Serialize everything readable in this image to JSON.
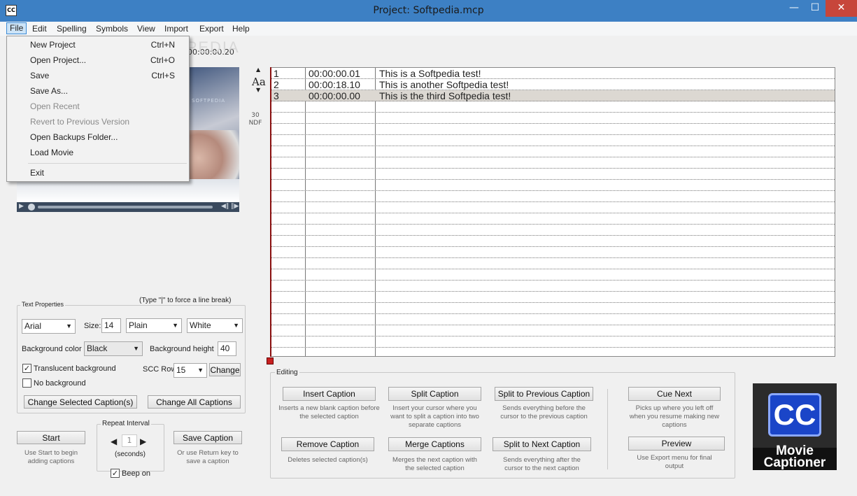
{
  "window": {
    "title": "Project: Softpedia.mcp",
    "minimize": "—",
    "maximize": "☐",
    "close": "✕",
    "app_icon": "cc-icon"
  },
  "menu": {
    "file": "File",
    "edit": "Edit",
    "spelling": "Spelling",
    "symbols": "Symbols",
    "view": "View",
    "import": "Import",
    "export": "Export",
    "help": "Help"
  },
  "file_menu": {
    "new_project": "New Project",
    "new_project_sc": "Ctrl+N",
    "open_project": "Open Project...",
    "open_project_sc": "Ctrl+O",
    "save": "Save",
    "save_sc": "Ctrl+S",
    "save_as": "Save As...",
    "open_recent": "Open Recent",
    "revert": "Revert to Previous Version",
    "open_backups": "Open Backups Folder...",
    "load_movie": "Load Movie",
    "exit": "Exit"
  },
  "player": {
    "timecode": "00:00:00.20",
    "watermark": "SOFTPEDIA",
    "brand_text": "SOFTPEDIA"
  },
  "caption_nav": {
    "font_icon": "Aa",
    "fps": "30",
    "fps_mode": "NDF"
  },
  "captions": [
    {
      "num": "1",
      "time": "00:00:00.01",
      "text": "This is a Softpedia test!"
    },
    {
      "num": "2",
      "time": "00:00:18.10",
      "text": "This is another Softpedia test!"
    },
    {
      "num": "3",
      "time": "00:00:00.00",
      "text": "This is the third Softpedia test!"
    }
  ],
  "text_properties": {
    "title": "Text Properties",
    "line_break_hint": "(Type  \"|\" to force a line break)",
    "font": "Arial",
    "size_label": "Size:",
    "size": "14",
    "style": "Plain",
    "color": "White",
    "bg_color_label": "Background color",
    "bg_color": "Black",
    "bg_height_label": "Background height",
    "bg_height": "40",
    "translucent_label": "Translucent background",
    "no_bg_label": "No background",
    "scc_row_label": "SCC Row:",
    "scc_row": "15",
    "change": "Change",
    "change_selected": "Change Selected Caption(s)",
    "change_all": "Change All Captions"
  },
  "capture": {
    "start": "Start",
    "start_hint": "Use Start to begin adding captions",
    "repeat_interval": "Repeat Interval",
    "interval_value": "1",
    "seconds": "(seconds)",
    "save_caption": "Save Caption",
    "save_hint": "Or use Return key to save a caption",
    "beep_on": "Beep on"
  },
  "editing": {
    "title": "Editing",
    "insert": "Insert Caption",
    "insert_hint": "Inserts a new blank caption before the selected caption",
    "split": "Split Caption",
    "split_hint": "Insert your cursor where you want to split a caption into two separate captions",
    "split_prev": "Split to Previous Caption",
    "split_prev_hint": "Sends everything before the cursor to the previous caption",
    "remove": "Remove Caption",
    "remove_hint": "Deletes selected caption(s)",
    "merge": "Merge Captions",
    "merge_hint": "Merges the next caption with the selected caption",
    "split_next": "Split to Next Caption",
    "split_next_hint": "Sends everything after the cursor to the next caption",
    "cue_next": "Cue Next",
    "cue_next_hint": "Picks up where you left off when you resume making new captions",
    "preview": "Preview",
    "preview_hint": "Use Export menu for final output"
  },
  "logo": {
    "cc": "CC",
    "line1": "Movie",
    "line2": "Captioner"
  }
}
